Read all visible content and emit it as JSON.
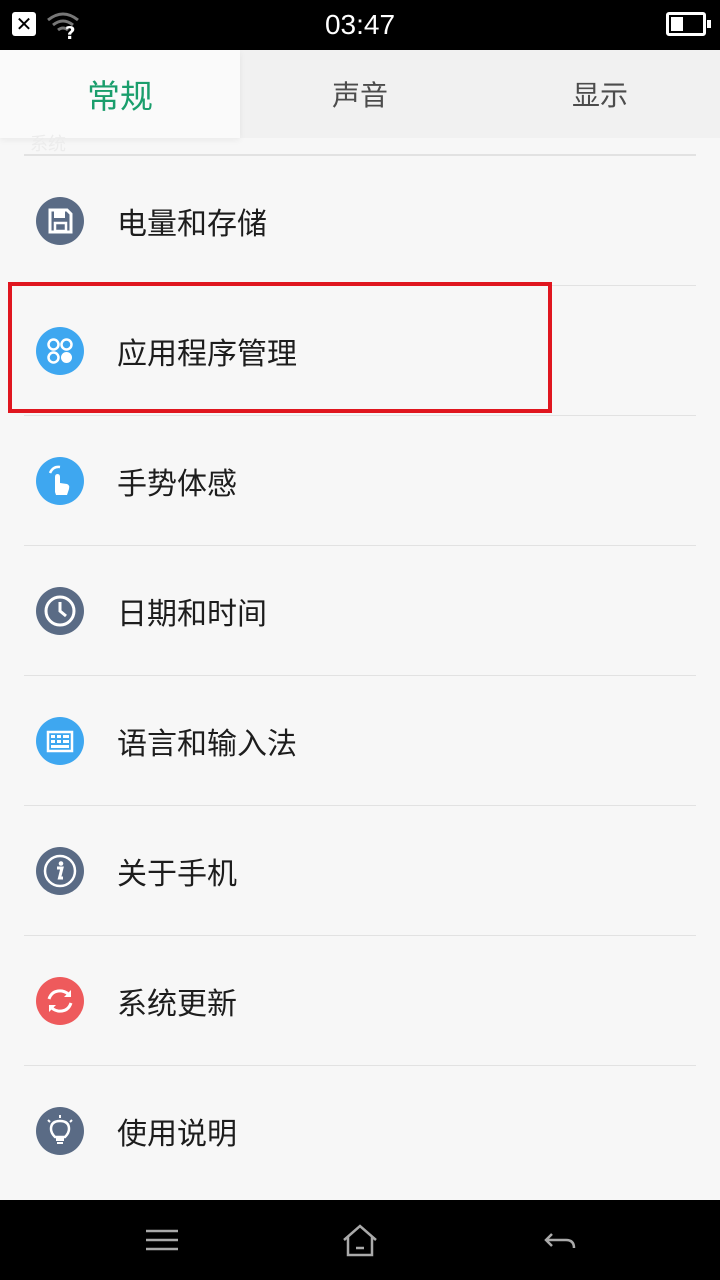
{
  "status_bar": {
    "time": "03:47",
    "close_symbol": "✕"
  },
  "tabs": [
    {
      "label": "常规"
    },
    {
      "label": "声音"
    },
    {
      "label": "显示"
    }
  ],
  "section_hint": "系统",
  "settings": [
    {
      "label": "电量和存储",
      "icon": "floppy-disk-icon",
      "color": "#5a6b85"
    },
    {
      "label": "应用程序管理",
      "icon": "app-grid-icon",
      "color": "#3ea7f0"
    },
    {
      "label": "手势体感",
      "icon": "hand-gesture-icon",
      "color": "#3ea7f0"
    },
    {
      "label": "日期和时间",
      "icon": "clock-icon",
      "color": "#5a6b85"
    },
    {
      "label": "语言和输入法",
      "icon": "keyboard-icon",
      "color": "#3ea7f0"
    },
    {
      "label": "关于手机",
      "icon": "info-icon",
      "color": "#5a6b85"
    },
    {
      "label": "系统更新",
      "icon": "refresh-icon",
      "color": "#ee5a5c"
    },
    {
      "label": "使用说明",
      "icon": "lightbulb-icon",
      "color": "#5a6b85"
    }
  ],
  "colors": {
    "accent": "#1a9e6c",
    "highlight": "#e0161f"
  }
}
